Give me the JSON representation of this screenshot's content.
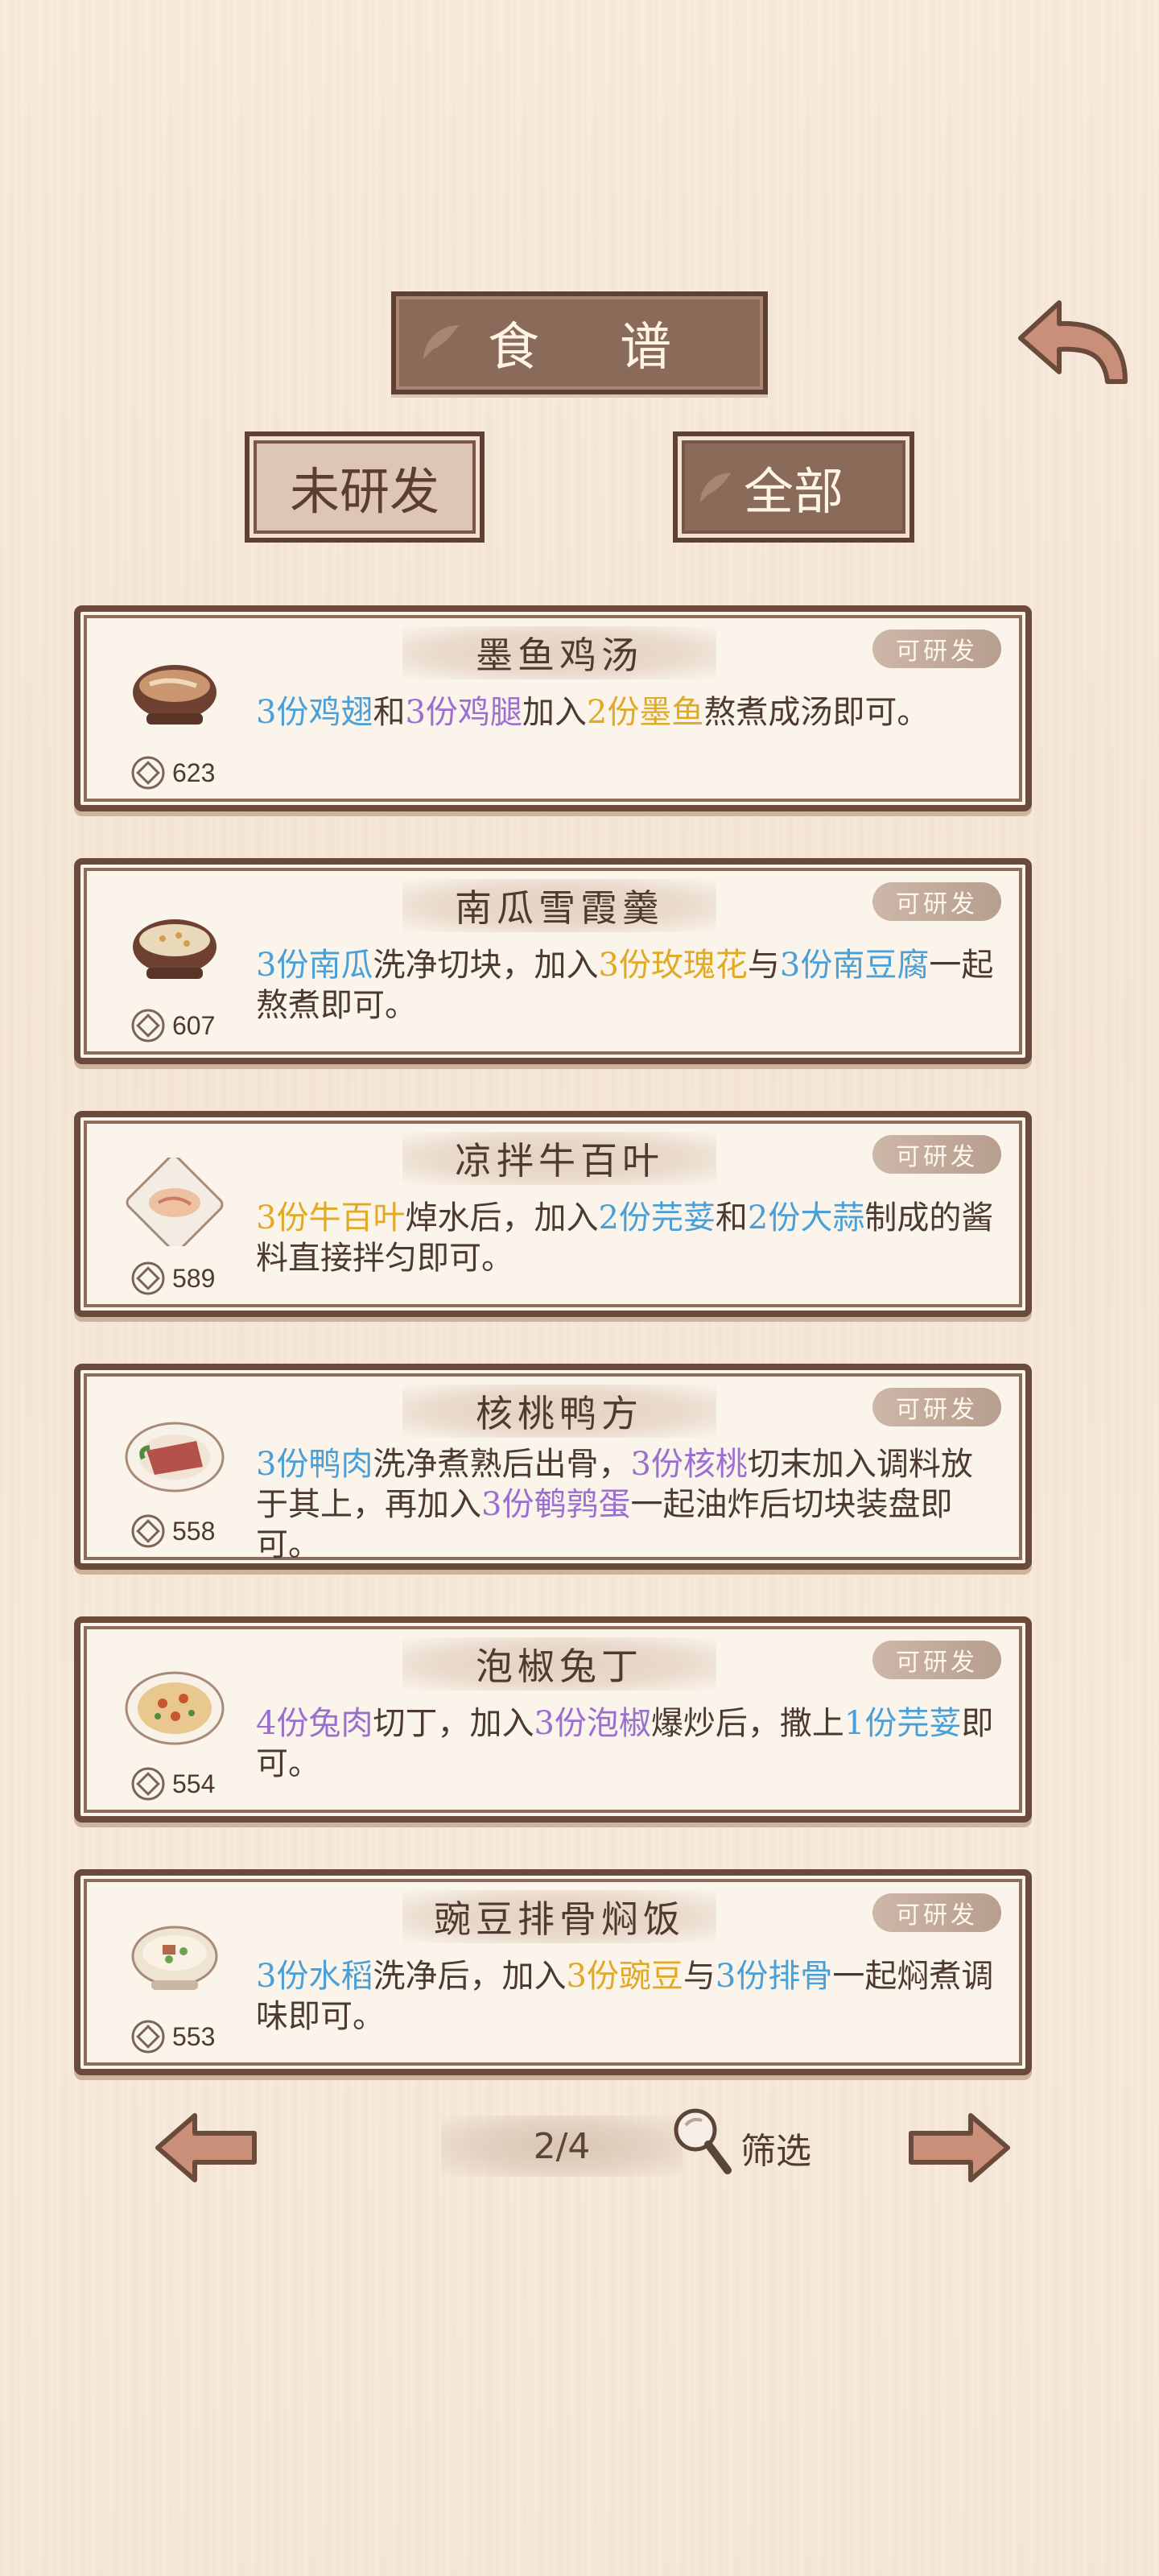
{
  "header": {
    "title": "食 谱",
    "back_icon": "back-arrow-icon"
  },
  "filters": {
    "unresearched_label": "未研发",
    "all_label": "全部"
  },
  "recipes": [
    {
      "name": "墨鱼鸡汤",
      "badge": "可研发",
      "price": "623",
      "desc": [
        {
          "t": "3份鸡翅",
          "c": "blue"
        },
        {
          "t": "和"
        },
        {
          "t": "3份鸡腿",
          "c": "purple"
        },
        {
          "t": "加入"
        },
        {
          "t": "2份墨鱼",
          "c": "gold"
        },
        {
          "t": "熬煮成汤即可。"
        }
      ]
    },
    {
      "name": "南瓜雪霞羹",
      "badge": "可研发",
      "price": "607",
      "desc": [
        {
          "t": "3份南瓜",
          "c": "blue"
        },
        {
          "t": "洗净切块，加入"
        },
        {
          "t": "3份玫瑰花",
          "c": "gold"
        },
        {
          "t": "与"
        },
        {
          "t": "3份南豆腐",
          "c": "blue"
        },
        {
          "t": "一起熬煮即可。"
        }
      ]
    },
    {
      "name": "凉拌牛百叶",
      "badge": "可研发",
      "price": "589",
      "desc": [
        {
          "t": "3份牛百叶",
          "c": "gold"
        },
        {
          "t": "焯水后，加入"
        },
        {
          "t": "2份芫荽",
          "c": "blue"
        },
        {
          "t": "和"
        },
        {
          "t": "2份大蒜",
          "c": "blue"
        },
        {
          "t": "制成的酱料直接拌匀即可。"
        }
      ]
    },
    {
      "name": "核桃鸭方",
      "badge": "可研发",
      "price": "558",
      "desc": [
        {
          "t": "3份鸭肉",
          "c": "blue"
        },
        {
          "t": "洗净煮熟后出骨，"
        },
        {
          "t": "3份核桃",
          "c": "purple"
        },
        {
          "t": "切末加入调料放于其上，再加入"
        },
        {
          "t": "3份鹌鹑蛋",
          "c": "purple"
        },
        {
          "t": "一起油炸后切块装盘即可。"
        }
      ]
    },
    {
      "name": "泡椒兔丁",
      "badge": "可研发",
      "price": "554",
      "desc": [
        {
          "t": "4份兔肉",
          "c": "purple"
        },
        {
          "t": "切丁，加入"
        },
        {
          "t": "3份泡椒",
          "c": "purple"
        },
        {
          "t": "爆炒后，撒上"
        },
        {
          "t": "1份芫荽",
          "c": "blue"
        },
        {
          "t": "即可。"
        }
      ]
    },
    {
      "name": "豌豆排骨焖饭",
      "badge": "可研发",
      "price": "553",
      "desc": [
        {
          "t": "3份水稻",
          "c": "blue"
        },
        {
          "t": "洗净后，加入"
        },
        {
          "t": "3份豌豆",
          "c": "gold"
        },
        {
          "t": "与"
        },
        {
          "t": "3份排骨",
          "c": "blue"
        },
        {
          "t": "一起焖煮调味即可。"
        }
      ]
    }
  ],
  "pager": {
    "page": "2/4",
    "filter_label": "筛选"
  },
  "colors": {
    "blue": "#4a9fd6",
    "purple": "#9a6fd0",
    "gold": "#e0aa27",
    "frame": "#6a4a3b"
  }
}
